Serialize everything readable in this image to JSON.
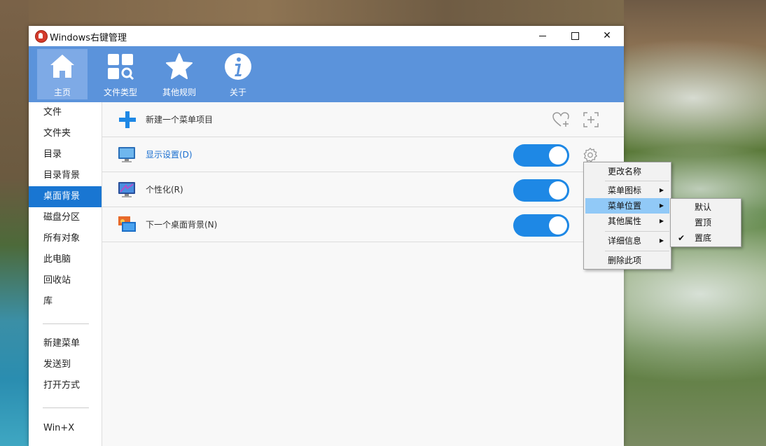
{
  "window": {
    "title": "Windows右键管理",
    "minimize": "minimize",
    "maximize": "maximize",
    "close": "✕"
  },
  "toolbar": {
    "items": [
      {
        "label": "主页",
        "icon": "home-icon"
      },
      {
        "label": "文件类型",
        "icon": "file-types-icon"
      },
      {
        "label": "其他规则",
        "icon": "star-icon"
      },
      {
        "label": "关于",
        "icon": "info-icon"
      }
    ]
  },
  "sidebar": {
    "items": [
      "文件",
      "文件夹",
      "目录",
      "目录背景",
      "桌面背景",
      "磁盘分区",
      "所有对象",
      "此电脑",
      "回收站",
      "库"
    ],
    "items2": [
      "新建菜单",
      "发送到",
      "打开方式"
    ],
    "items3": [
      "Win+X"
    ],
    "active_index": 4
  },
  "main": {
    "new_item_label": "新建一个菜单项目",
    "rows": [
      {
        "label": "显示设置(D)",
        "enabled": true
      },
      {
        "label": "个性化(R)",
        "enabled": true
      },
      {
        "label": "下一个桌面背景(N)",
        "enabled": true
      }
    ]
  },
  "context_menu": {
    "items": [
      "更改名称",
      "菜单图标",
      "菜单位置",
      "其他属性",
      "详细信息",
      "删除此项"
    ],
    "highlighted": "菜单位置"
  },
  "submenu": {
    "items": [
      "默认",
      "置顶",
      "置底"
    ],
    "checked": "置底"
  },
  "colors": {
    "toolbar_bg": "#5b93db",
    "active_sidebar": "#1976d2",
    "toggle_on": "#1e88e5",
    "menu_highlight": "#91c9f7"
  }
}
